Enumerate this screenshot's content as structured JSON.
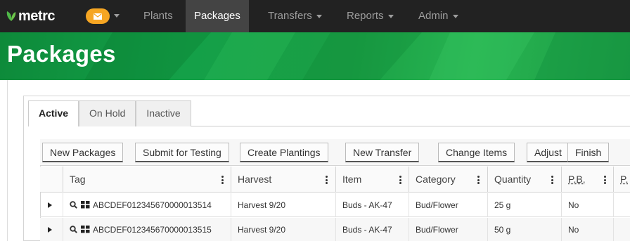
{
  "brand": {
    "name": "metrc",
    "accent": "#f6a623",
    "leaf_color": "#4fb848"
  },
  "nav": {
    "mail_icon": "envelope-icon",
    "items": [
      {
        "label": "Plants",
        "dropdown": false
      },
      {
        "label": "Packages",
        "dropdown": false,
        "active": true
      },
      {
        "label": "Transfers",
        "dropdown": true
      },
      {
        "label": "Reports",
        "dropdown": true
      },
      {
        "label": "Admin",
        "dropdown": true
      }
    ]
  },
  "page": {
    "title": "Packages",
    "banner_color": "#1a9f45"
  },
  "tabs": [
    {
      "label": "Active",
      "active": true
    },
    {
      "label": "On Hold"
    },
    {
      "label": "Inactive"
    }
  ],
  "toolbar": {
    "buttons": [
      "New Packages",
      "Submit for Testing",
      "Create Plantings",
      "New Transfer",
      "Change Items",
      "Adjust",
      "Finish"
    ]
  },
  "table": {
    "columns": [
      "Tag",
      "Harvest",
      "Item",
      "Category",
      "Quantity",
      "P.B.",
      "P."
    ],
    "rows": [
      {
        "tag": "ABCDEF012345670000013514",
        "harvest": "Harvest 9/20",
        "item": "Buds - AK-47",
        "category": "Bud/Flower",
        "quantity": "25 g",
        "pb": "No"
      },
      {
        "tag": "ABCDEF012345670000013515",
        "harvest": "Harvest 9/20",
        "item": "Buds - AK-47",
        "category": "Bud/Flower",
        "quantity": "50 g",
        "pb": "No"
      }
    ]
  }
}
